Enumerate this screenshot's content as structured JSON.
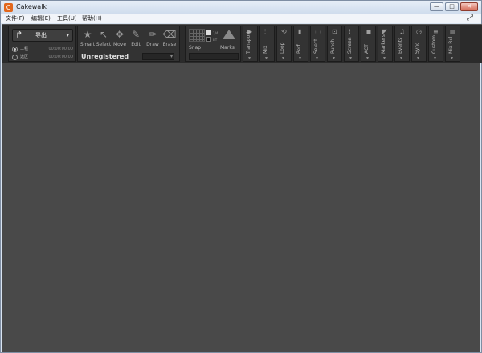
{
  "window": {
    "title": "Cakewalk",
    "app_icon_glyph": "C",
    "minimize_glyph": "—",
    "maximize_glyph": "□",
    "close_glyph": "✕"
  },
  "menu": [
    {
      "label": "文件(F)"
    },
    {
      "label": "编辑(E)"
    },
    {
      "label": "工具(U)"
    },
    {
      "label": "帮助(H)"
    }
  ],
  "toolbar": {
    "export": {
      "label": "导出",
      "arrow_glyph": "↱",
      "caret": "▾",
      "options": [
        {
          "label": "工程",
          "time": "00:00:00:00",
          "selected": true
        },
        {
          "label": "选区",
          "time": "00:00:00:00",
          "selected": false
        }
      ]
    },
    "tools": [
      {
        "label": "Smart",
        "icon": "smart-star-icon",
        "glyph": "★"
      },
      {
        "label": "Select",
        "icon": "select-arrow-icon",
        "glyph": "↖"
      },
      {
        "label": "Move",
        "icon": "move-cross-icon",
        "glyph": "✥"
      },
      {
        "label": "Edit",
        "icon": "edit-wrench-icon",
        "glyph": "✎"
      },
      {
        "label": "Draw",
        "icon": "draw-pencil-icon",
        "glyph": "✏"
      },
      {
        "label": "Erase",
        "icon": "erase-icon",
        "glyph": "⌫"
      }
    ],
    "registration_text": "Unregistered",
    "tool_combo_caret": "▾",
    "snap": {
      "label": "Snap",
      "marks_label": "Marks",
      "mini_labels": [
        "1/4",
        "BT"
      ]
    },
    "modules": [
      {
        "label": "Transport",
        "icon": "transport-icon",
        "glyph": "▶"
      },
      {
        "label": "Mix",
        "icon": "mix-faders-icon",
        "glyph": "⫶"
      },
      {
        "label": "Loop",
        "icon": "loop-icon",
        "glyph": "⟲"
      },
      {
        "label": "Perf",
        "icon": "perf-bars-icon",
        "glyph": "▮"
      },
      {
        "label": "Select",
        "icon": "select-range-icon",
        "glyph": "⬚"
      },
      {
        "label": "Punch",
        "icon": "punch-icon",
        "glyph": "⊡"
      },
      {
        "label": "Screen",
        "icon": "screenset-icon",
        "glyph": "⁞"
      },
      {
        "label": "ACT",
        "icon": "act-icon",
        "glyph": "▣"
      },
      {
        "label": "Markers",
        "icon": "markers-flag-icon",
        "glyph": "◤"
      },
      {
        "label": "Events",
        "icon": "events-icon",
        "glyph": "♫"
      },
      {
        "label": "Sync",
        "icon": "sync-clock-icon",
        "glyph": "◷"
      },
      {
        "label": "Custom",
        "icon": "custom-icon",
        "glyph": "≡"
      },
      {
        "label": "Mix Rcl",
        "icon": "mix-recall-icon",
        "glyph": "▤"
      }
    ],
    "module_caret": "▾"
  },
  "colors": {
    "workspace": "#494949",
    "toolbar": "#2b2b2b",
    "module": "#333333",
    "title_bar": "#d9e4f1"
  }
}
